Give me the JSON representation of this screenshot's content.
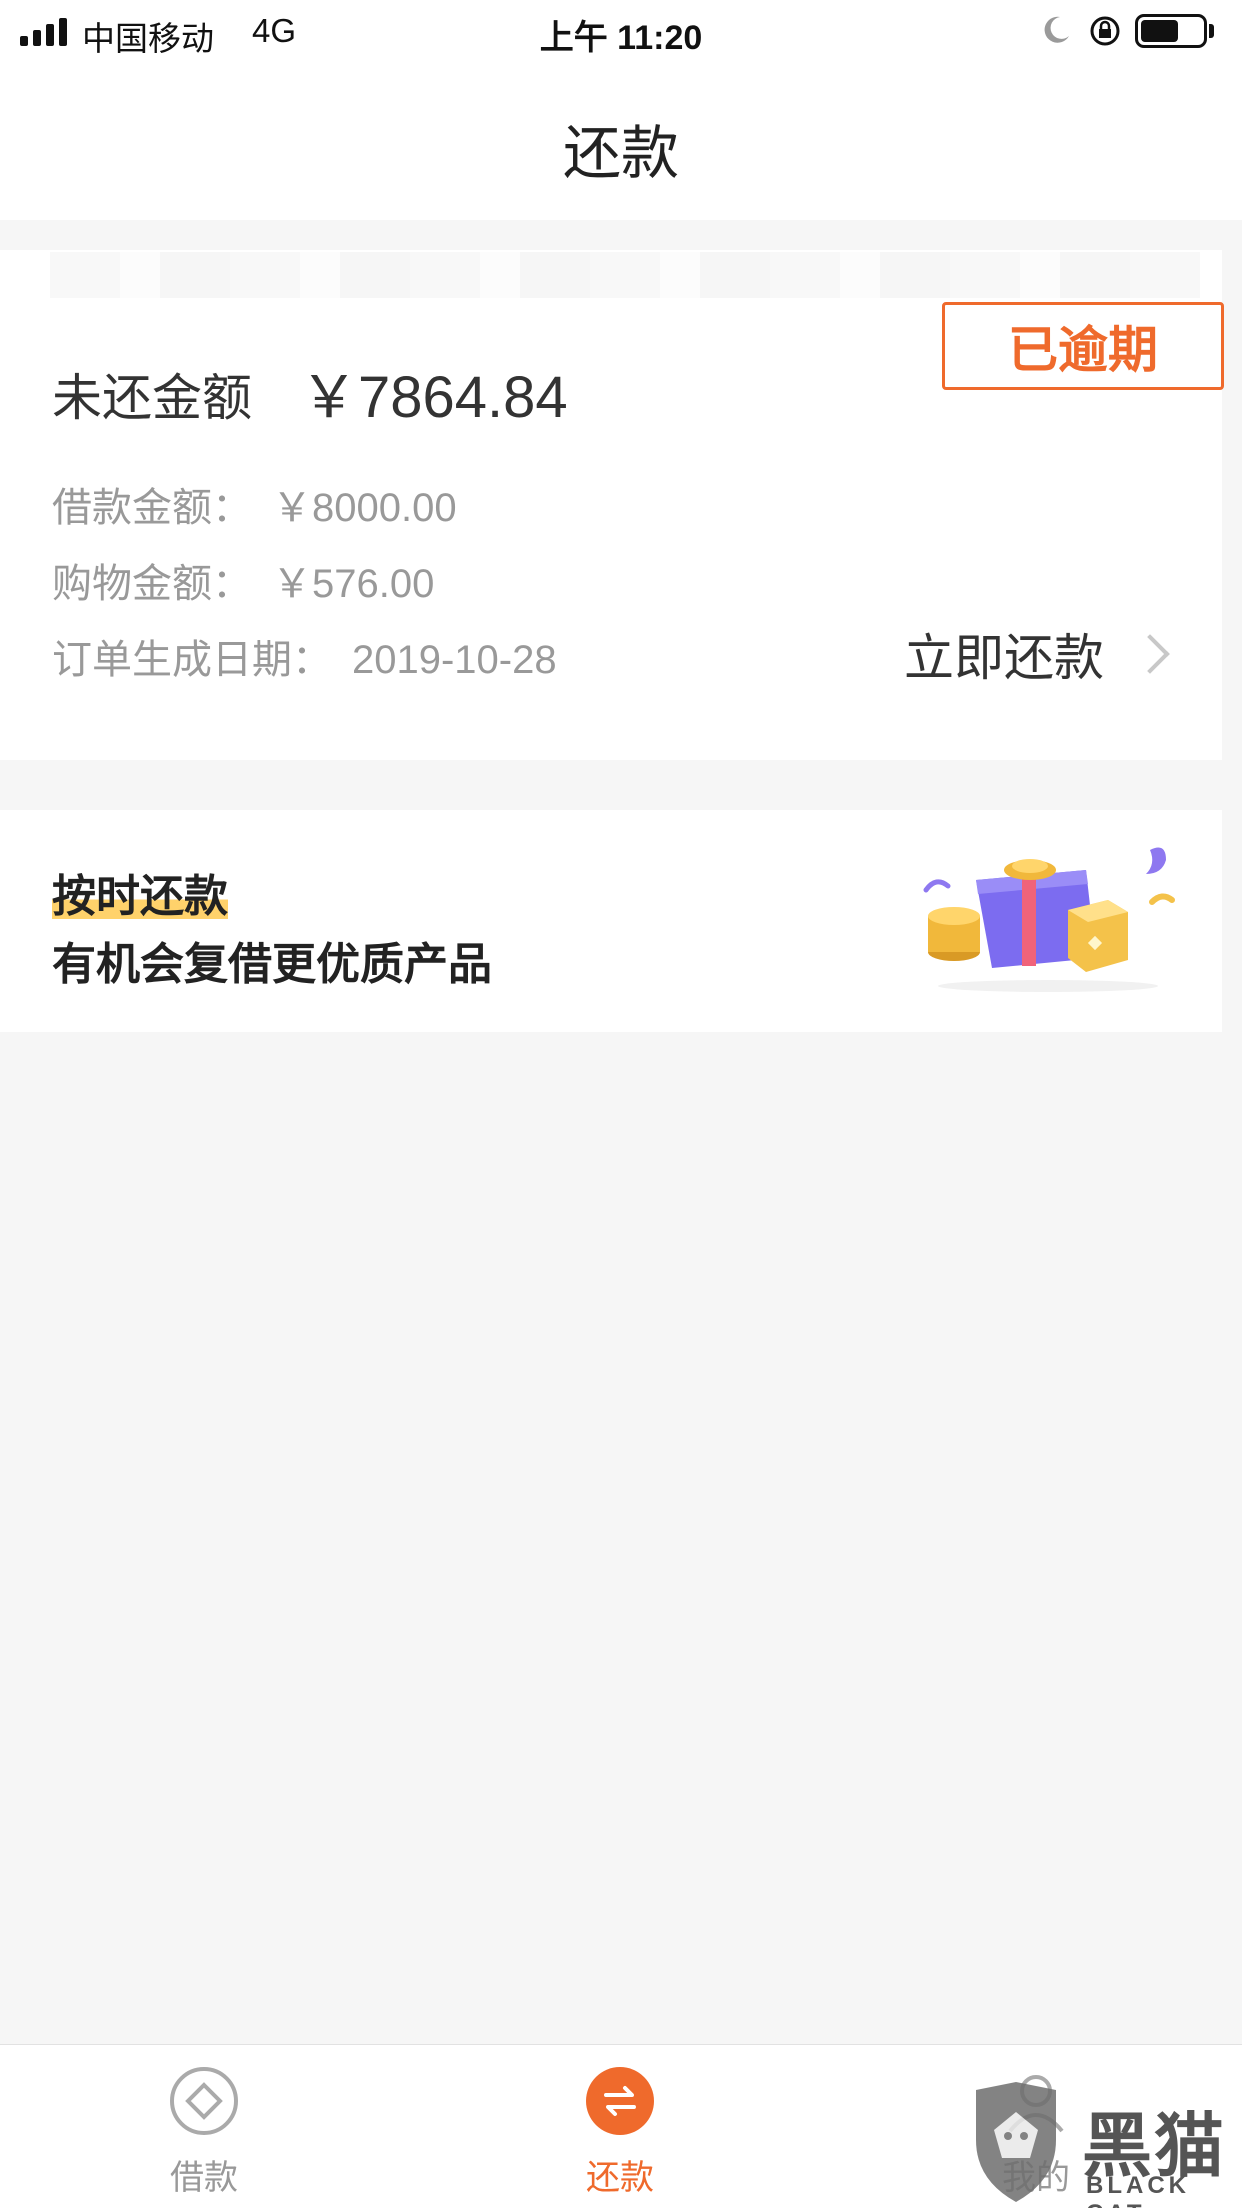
{
  "status_bar": {
    "carrier": "中国移动",
    "network": "4G",
    "time": "上午 11:20",
    "icons": [
      "signal-icon",
      "moon-icon",
      "rotation-lock-icon",
      "battery-icon"
    ],
    "battery_level": 0.62
  },
  "nav": {
    "title": "还款"
  },
  "loan_card": {
    "status_badge": "已逾期",
    "outstanding_label": "未还金额",
    "outstanding_value": "￥7864.84",
    "rows": [
      {
        "label": "借款金额：",
        "value": "￥8000.00"
      },
      {
        "label": "购物金额：",
        "value": "￥576.00"
      },
      {
        "label": "订单生成日期：",
        "value": "2019-10-28"
      }
    ],
    "repay_now": "立即还款"
  },
  "promo": {
    "title": "按时还款",
    "subtitle": "有机会复借更优质产品",
    "illustration": "gift-box-coins-icon"
  },
  "tab_bar": {
    "items": [
      {
        "label": "借款",
        "icon": "borrow-icon",
        "active": false
      },
      {
        "label": "还款",
        "icon": "repay-icon",
        "active": true
      },
      {
        "label": "我的",
        "icon": "profile-icon",
        "active": false
      }
    ]
  },
  "watermark": {
    "text": "黑猫",
    "sub": "BLACK CAT"
  },
  "colors": {
    "accent": "#ef6a2c",
    "highlight": "#ffd26b",
    "background": "#f6f6f6"
  }
}
